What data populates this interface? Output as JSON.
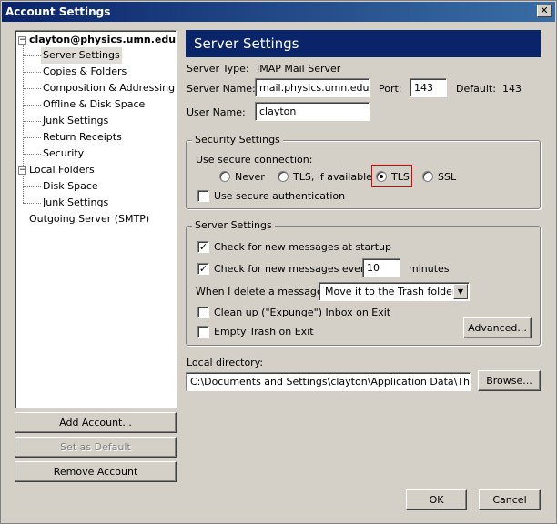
{
  "window": {
    "title": "Account Settings",
    "close_glyph": "✕"
  },
  "tree": {
    "account": "clayton@physics.umn.edu",
    "account_items": [
      "Server Settings",
      "Copies & Folders",
      "Composition & Addressing",
      "Offline & Disk Space",
      "Junk Settings",
      "Return Receipts",
      "Security"
    ],
    "local_folders": "Local Folders",
    "local_items": [
      "Disk Space",
      "Junk Settings"
    ],
    "outgoing": "Outgoing Server (SMTP)"
  },
  "left_buttons": {
    "add_account": "Add Account...",
    "set_default": "Set as Default",
    "remove_account": "Remove Account"
  },
  "panel": {
    "title": "Server Settings",
    "server_type_label": "Server Type:",
    "server_type_value": "IMAP Mail Server",
    "server_name_label": "Server Name:",
    "server_name_value": "mail.physics.umn.edu",
    "port_label": "Port:",
    "port_value": "143",
    "default_label": "Default:",
    "default_value": "143",
    "user_name_label": "User Name:",
    "user_name_value": "clayton"
  },
  "security": {
    "legend": "Security Settings",
    "use_secure_label": "Use secure connection:",
    "options": [
      "Never",
      "TLS, if available",
      "TLS",
      "SSL"
    ],
    "selected": "TLS",
    "secure_auth_label": "Use secure authentication",
    "secure_auth_checked": false
  },
  "server_settings": {
    "legend": "Server Settings",
    "check_startup_label": "Check for new messages at startup",
    "check_startup_checked": true,
    "check_every_label": "Check for new messages every",
    "check_every_checked": true,
    "check_every_value": "10",
    "minutes_label": "minutes",
    "delete_label": "When I delete a message:",
    "delete_value": "Move it to the Trash folder",
    "cleanup_label": "Clean up (\"Expunge\") Inbox on Exit",
    "cleanup_checked": false,
    "empty_trash_label": "Empty Trash on Exit",
    "empty_trash_checked": false,
    "advanced_label": "Advanced..."
  },
  "local_directory": {
    "label": "Local directory:",
    "value": "C:\\Documents and Settings\\clayton\\Application Data\\Thunderbi",
    "browse_label": "Browse..."
  },
  "footer": {
    "ok": "OK",
    "cancel": "Cancel"
  },
  "colors": {
    "header_bg": "#0a246a",
    "dialog_bg": "#d4d0c8",
    "highlight": "#e00000"
  }
}
